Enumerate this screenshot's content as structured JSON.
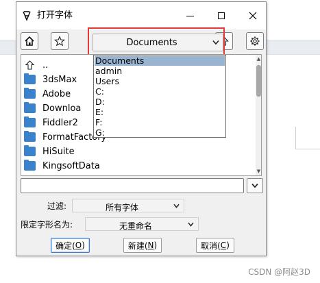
{
  "window": {
    "title": "打开字体"
  },
  "toolbar": {
    "home_icon": "home-icon",
    "bookmark_icon": "star-icon",
    "up_icon": "up-arrow-icon",
    "settings_icon": "gear-icon",
    "path_value": "Documents"
  },
  "path_dropdown": {
    "options": [
      "Documents",
      "admin",
      "Users",
      "C:",
      "D:",
      "E:",
      "F:",
      "G:"
    ],
    "selected": "Documents"
  },
  "files": [
    {
      "name": "..",
      "type": "parent"
    },
    {
      "name": "3dsMax",
      "type": "folder"
    },
    {
      "name": "Adobe",
      "type": "folder"
    },
    {
      "name": "Downloa",
      "type": "folder"
    },
    {
      "name": "Fiddler2",
      "type": "folder"
    },
    {
      "name": "FormatFactory",
      "type": "folder"
    },
    {
      "name": "HiSuite",
      "type": "folder"
    },
    {
      "name": "KingsoftData",
      "type": "folder"
    }
  ],
  "filename_input": {
    "value": ""
  },
  "filter": {
    "label": "过滤:",
    "value": "所有字体"
  },
  "naming": {
    "label": "限定字形名为:",
    "value": "无重命名"
  },
  "buttons": {
    "ok": "确定(",
    "ok_key": "O",
    "ok_end": ")",
    "new": "新建(",
    "new_key": "N",
    "new_end": ")",
    "cancel": "取消(",
    "cancel_key": "C",
    "cancel_end": ")"
  },
  "watermark": "CSDN @阿赵3D",
  "colors": {
    "highlight_border": "#e53935",
    "selected_item": "#99b4d1",
    "folder": "#3a82cc"
  }
}
